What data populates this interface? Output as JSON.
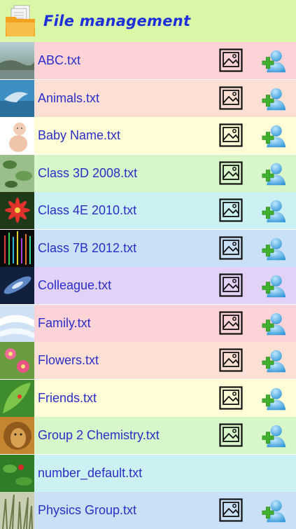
{
  "header": {
    "title": "File management",
    "icon": "folder-documents-icon"
  },
  "colors": {
    "title": "#1d2fd8",
    "filename": "#2a2ec8",
    "header_bg": "#d9f7a6"
  },
  "files": [
    {
      "name": "ABC.txt",
      "bg": "#fdd3d7",
      "thumb": "landscape",
      "has_actions": true
    },
    {
      "name": "Animals.txt",
      "bg": "#fde0d3",
      "thumb": "dolphin",
      "has_actions": true
    },
    {
      "name": "Baby Name.txt",
      "bg": "#fefdd5",
      "thumb": "baby",
      "has_actions": true
    },
    {
      "name": "Class 3D 2008.txt",
      "bg": "#d7f6c9",
      "thumb": "leaves",
      "has_actions": true
    },
    {
      "name": "Class 4E 2010.txt",
      "bg": "#cbf1f2",
      "thumb": "red-flower",
      "has_actions": true
    },
    {
      "name": "Class 7B 2012.txt",
      "bg": "#c9e0f7",
      "thumb": "neon-lines",
      "has_actions": true
    },
    {
      "name": "Colleague.txt",
      "bg": "#e2d2f7",
      "thumb": "galaxy",
      "has_actions": true
    },
    {
      "name": "Family.txt",
      "bg": "#fdd3d7",
      "thumb": "clouds",
      "has_actions": true
    },
    {
      "name": "Flowers.txt",
      "bg": "#fde0d3",
      "thumb": "pink-flowers",
      "has_actions": true
    },
    {
      "name": "Friends.txt",
      "bg": "#fefdd5",
      "thumb": "green-leaf",
      "has_actions": true
    },
    {
      "name": "Group 2 Chemistry.txt",
      "bg": "#d7f6c9",
      "thumb": "lion",
      "has_actions": true
    },
    {
      "name": "number_default.txt",
      "bg": "#cbf1f2",
      "thumb": "ladybug",
      "has_actions": false
    },
    {
      "name": "Physics Group.txt",
      "bg": "#c9e0f7",
      "thumb": "grass",
      "has_actions": true
    }
  ]
}
